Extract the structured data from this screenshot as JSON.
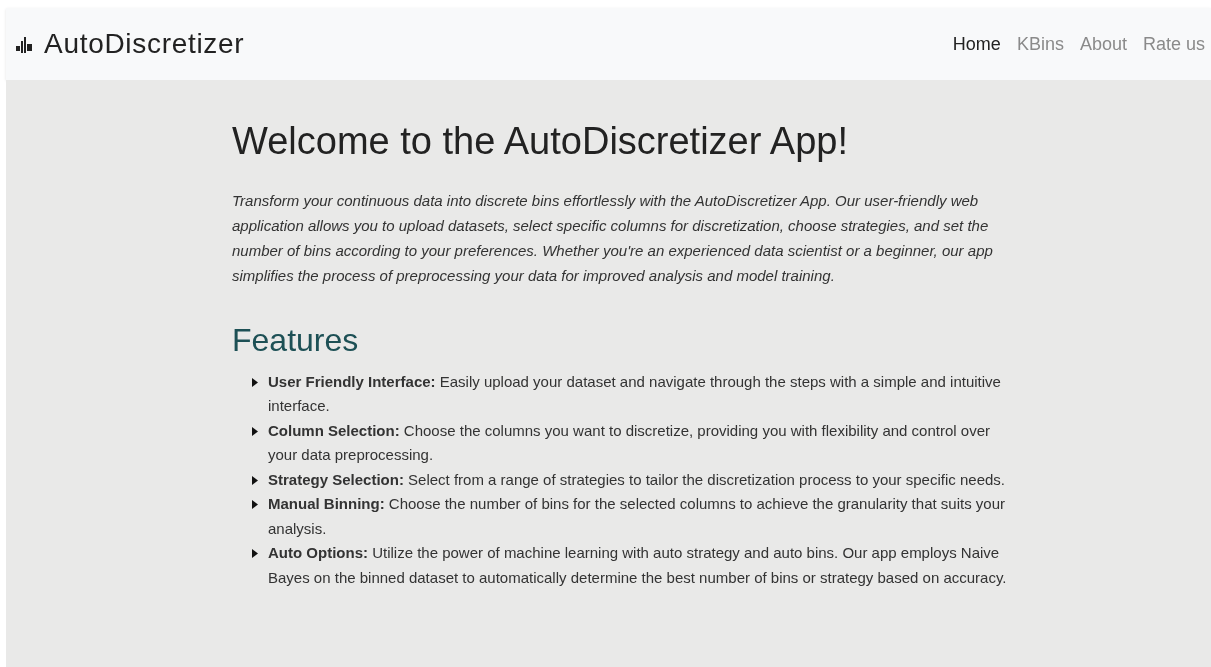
{
  "navbar": {
    "brand": "AutoDiscretizer",
    "links": [
      {
        "label": "Home",
        "selected": true
      },
      {
        "label": "KBins",
        "selected": false
      },
      {
        "label": "About",
        "selected": false
      },
      {
        "label": "Rate us",
        "selected": false
      }
    ]
  },
  "heading": "Welcome to the AutoDiscretizer App!",
  "intro": "Transform your continuous data into discrete bins effortlessly with the AutoDiscretizer App. Our user-friendly web application allows you to upload datasets, select specific columns for discretization, choose strategies, and set the number of bins according to your preferences. Whether you're an experienced data scientist or a beginner, our app simplifies the process of preprocessing your data for improved analysis and model training.",
  "features": {
    "title": "Features",
    "items": [
      "**User Friendly Interface:** Easily upload your dataset and navigate through the steps with a simple and intuitive interface.",
      "**Column Selection:** Choose the columns you want to discretize, providing you with flexibility and control over your data preprocessing.",
      "**Strategy Selection:** Select from a range of strategies to tailor the discretization process to your specific needs.",
      "**Manual Binning:** Choose the number of bins for the selected columns to achieve the granularity that suits your analysis.",
      "**Auto Options:** Utilize the power of machine learning with auto strategy and auto bins. Our app employs Naive Bayes on the binned dataset to automatically determine the best number of bins or strategy based on accuracy."
    ]
  }
}
